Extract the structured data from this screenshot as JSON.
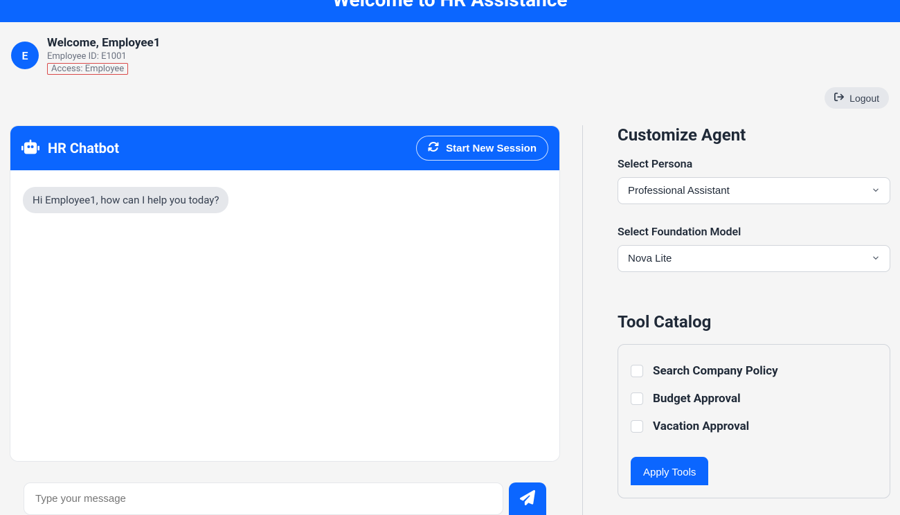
{
  "banner": {
    "title": "Welcome to HR Assistance"
  },
  "user": {
    "avatar_initial": "E",
    "welcome_text": "Welcome, Employee1",
    "employee_id_text": "Employee ID: E1001",
    "access_text": "Access: Employee"
  },
  "logout": {
    "label": "Logout"
  },
  "chat": {
    "title": "HR Chatbot",
    "new_session_label": "Start New Session",
    "bot_message": "Hi Employee1, how can I help you today?",
    "input_placeholder": "Type your message"
  },
  "customize": {
    "heading": "Customize Agent",
    "persona_label": "Select Persona",
    "persona_value": "Professional Assistant",
    "model_label": "Select Foundation Model",
    "model_value": "Nova Lite"
  },
  "tool_catalog": {
    "heading": "Tool Catalog",
    "items": [
      {
        "label": "Search Company Policy"
      },
      {
        "label": "Budget Approval"
      },
      {
        "label": "Vacation Approval"
      }
    ],
    "apply_label": "Apply Tools"
  }
}
